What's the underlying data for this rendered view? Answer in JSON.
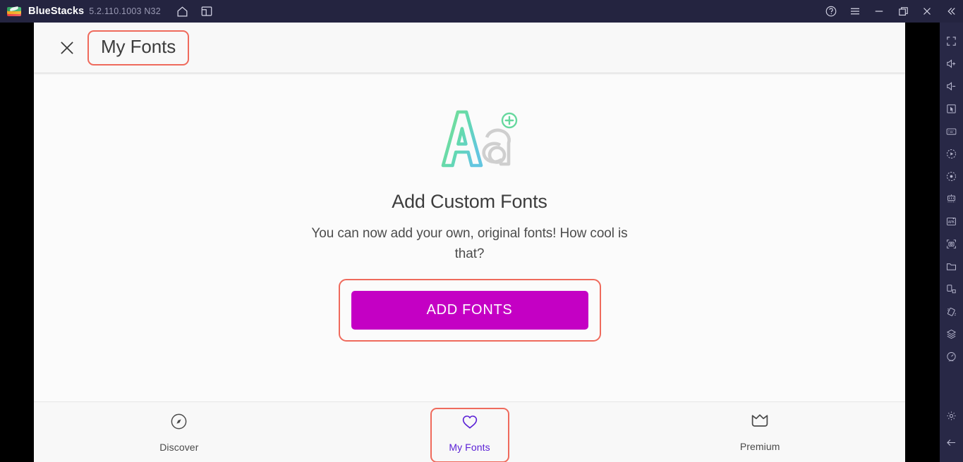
{
  "window": {
    "app_name": "BlueStacks",
    "version": "5.2.110.1003 N32",
    "logo_icon": "bluestacks-logo",
    "left_icons": [
      {
        "name": "home-icon",
        "label": "Home"
      },
      {
        "name": "multi-instance-icon",
        "label": "Instances"
      }
    ],
    "right_icons": [
      {
        "name": "help-icon",
        "label": "Help"
      },
      {
        "name": "hamburger-menu-icon",
        "label": "Menu"
      },
      {
        "name": "minimize-icon",
        "label": "Minimize"
      },
      {
        "name": "restore-icon",
        "label": "Restore"
      },
      {
        "name": "close-icon",
        "label": "Close"
      },
      {
        "name": "collapse-sidebar-icon",
        "label": "Collapse"
      }
    ]
  },
  "sidebar": {
    "items": [
      {
        "name": "fullscreen-icon",
        "label": "Fullscreen"
      },
      {
        "name": "volume-up-icon",
        "label": "Volume up"
      },
      {
        "name": "volume-down-icon",
        "label": "Volume down"
      },
      {
        "name": "cursor-pointer-icon",
        "label": "Pointer"
      },
      {
        "name": "keyboard-controls-icon",
        "label": "Game controls"
      },
      {
        "name": "macro-record-icon",
        "label": "Macro recorder"
      },
      {
        "name": "script-record-icon",
        "label": "Script recorder"
      },
      {
        "name": "multi-instance-manager-icon",
        "label": "Multi-instance manager"
      },
      {
        "name": "install-apk-icon",
        "label": "Install APK"
      },
      {
        "name": "screenshot-icon",
        "label": "Screenshot"
      },
      {
        "name": "media-folder-icon",
        "label": "Media manager"
      },
      {
        "name": "rotate-screen-icon",
        "label": "Rotate"
      },
      {
        "name": "shake-icon",
        "label": "Shake"
      },
      {
        "name": "eco-mode-icon",
        "label": "Eco mode"
      },
      {
        "name": "performance-icon",
        "label": "Performance"
      }
    ],
    "bottom_items": [
      {
        "name": "settings-gear-icon",
        "label": "Settings"
      },
      {
        "name": "back-arrow-icon",
        "label": "Back"
      }
    ]
  },
  "app": {
    "header": {
      "close_icon": "close-icon",
      "title": "My Fonts",
      "title_highlight_color": "#ef6a5c"
    },
    "empty_state": {
      "illustration_icon": "add-custom-fonts-illustration",
      "illustration_letters": {
        "big": "A",
        "small": "a",
        "badge": "+"
      },
      "title": "Add Custom Fonts",
      "subtitle": "You can now add your own, original fonts! How cool is that?",
      "cta_label": "ADD FONTS",
      "cta_color": "#c400c4",
      "cta_highlight_color": "#ef6a5c"
    },
    "bottom_nav": {
      "active_color": "#5b21d6",
      "inactive_color": "#4a4a4a",
      "highlight_color": "#ef6a5c",
      "items": [
        {
          "name": "tab-discover",
          "label": "Discover",
          "icon": "compass-icon",
          "active": false,
          "highlighted": false
        },
        {
          "name": "tab-my-fonts",
          "label": "My Fonts",
          "icon": "heart-icon",
          "active": true,
          "highlighted": true
        },
        {
          "name": "tab-premium",
          "label": "Premium",
          "icon": "crown-icon",
          "active": false,
          "highlighted": false
        }
      ]
    }
  }
}
